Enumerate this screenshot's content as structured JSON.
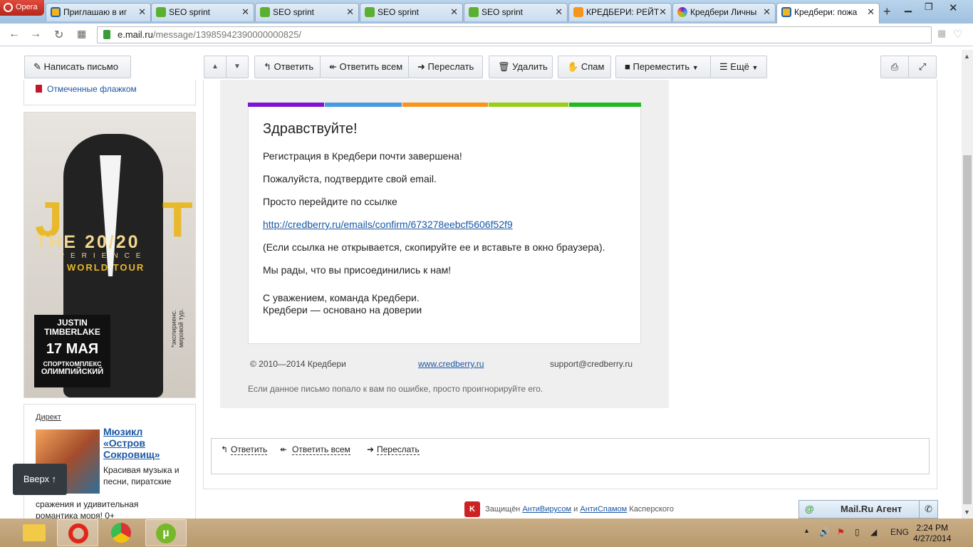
{
  "browser": {
    "opera_label": "Opera",
    "tabs": [
      {
        "title": "Приглашаю в иг",
        "left": 0
      },
      {
        "title": "SEO sprint"
      },
      {
        "title": "SEO sprint"
      },
      {
        "title": "SEO sprint"
      },
      {
        "title": "SEO sprint"
      },
      {
        "title": "КРЕДБЕРИ: РЕЙТ"
      },
      {
        "title": "Кредбери Личны"
      },
      {
        "title": "Кредбери: пожа"
      }
    ],
    "new_tab": "+",
    "url_host": "e.mail.ru",
    "url_path": "/message/13985942390000000825/"
  },
  "toolbar": {
    "compose": "Написать письмо",
    "reply": "Ответить",
    "reply_all": "Ответить всем",
    "forward": "Переслать",
    "delete": "Удалить",
    "spam": "Спам",
    "move": "Переместить",
    "more": "Ещё"
  },
  "sidebar": {
    "flagged": "Отмеченные флажком"
  },
  "banner": {
    "jt": "JT",
    "title": "THE 20/20",
    "experience": "EXPERIENCE",
    "tour": "WORLD TOUR",
    "artist": "JUSTIN TIMBERLAKE",
    "date": "17 МАЯ",
    "venue_line1": "СПОРТКОМПЛЕКС",
    "venue_line2": "ОЛИМПИЙСКИЙ",
    "note": "*экспириенс. мировой тур."
  },
  "direct": {
    "label": "Директ",
    "headline": "Мюзикл «Остров Сокровищ»",
    "body": "Красивая музыка и песни, пиратские",
    "body2": "сражения и удивительная романтика моря! 0+"
  },
  "up_button": "Вверх ↑",
  "letter": {
    "greeting": "Здравствуйте!",
    "p1": "Регистрация в Кредбери почти завершена!",
    "p2": "Пожалуйста, подтвердите свой email.",
    "p3": "Просто перейдите по ссылке",
    "link": "http://credberry.ru/emails/confirm/673278eebcf5606f52f9",
    "p4": "(Если ссылка не открывается, скопируйте ее и вставьте в окно браузера).",
    "p5": "Мы рады, что вы присоединились к нам!",
    "sign1": "С уважением, команда Кредбери.",
    "sign2": "Кредбери — основано на доверии",
    "copyright": "© 2010—2014 Кредбери",
    "site": "www.credberry.ru",
    "support": "support@credberry.ru",
    "ignore": "Если данное письмо попало к вам по ошибке, просто проигнорируйте его.",
    "stripe_colors": [
      "#7d16d1",
      "#4a9ae0",
      "#f7941d",
      "#9acd18",
      "#21b821"
    ]
  },
  "quick_reply": {
    "reply": "Ответить",
    "reply_all": "Ответить всем",
    "forward": "Переслать"
  },
  "kaspersky": {
    "prefix": "Защищён",
    "antivirus": "АнтиВирусом",
    "and": "и",
    "antispam": "АнтиСпамом",
    "suffix": "Касперского"
  },
  "agent": {
    "label": "Mail.Ru Агент"
  },
  "taskbar": {
    "lang": "ENG",
    "time": "2:24 PM",
    "date": "4/27/2014"
  }
}
